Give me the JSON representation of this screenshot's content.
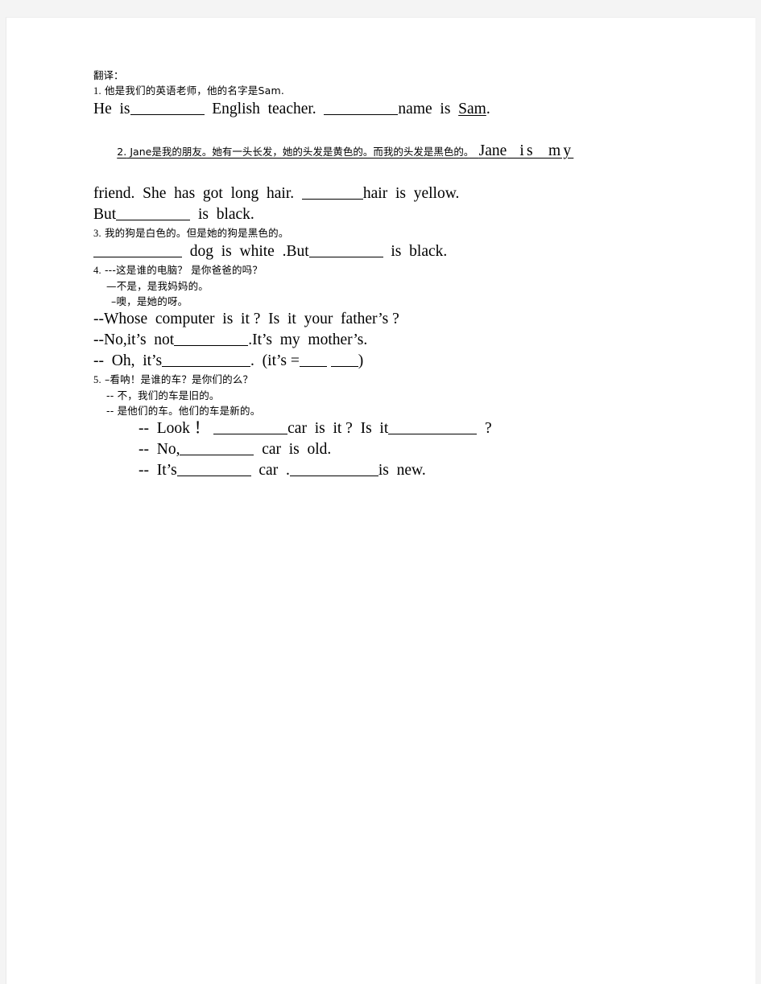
{
  "document": {
    "heading": "翻译：",
    "items": [
      {
        "id": "item-1",
        "number": "1.",
        "chinese": "他是我们的英语老师，他的名字是Sam.",
        "english_lines": [
          {
            "id": "item-1-answer-line",
            "segments": [
              {
                "type": "text",
                "value": "He  is"
              },
              {
                "type": "blank",
                "size": "lg"
              },
              {
                "type": "text",
                "value": "  English  teacher.  "
              },
              {
                "type": "blank",
                "size": "lg"
              },
              {
                "type": "text",
                "value": "name  is  "
              },
              {
                "type": "underlined",
                "value": "Sam"
              },
              {
                "type": "text",
                "value": "."
              }
            ]
          }
        ]
      },
      {
        "id": "item-2",
        "number": "2.",
        "chinese": "Jane是我的朋友。她有一头长发，她的头发是黄色的。而我的头发是黑色的。",
        "trailing_english": "Jane  is  my",
        "trailing_english_underlined_word": "Jane",
        "english_lines": [
          {
            "id": "item-2-answer-line-1",
            "segments": [
              {
                "type": "text",
                "value": "friend.  She  has  got  long  hair.  "
              },
              {
                "type": "blank",
                "size": "md"
              },
              {
                "type": "text",
                "value": "hair  is  yellow."
              }
            ]
          },
          {
            "id": "item-2-answer-line-2",
            "segments": [
              {
                "type": "text",
                "value": "But"
              },
              {
                "type": "blank",
                "size": "lg"
              },
              {
                "type": "text",
                "value": "  is  black."
              }
            ]
          }
        ]
      },
      {
        "id": "item-3",
        "number": "3.",
        "chinese": "我的狗是白色的。但是她的狗是黑色的。",
        "english_lines": [
          {
            "id": "item-3-answer-line",
            "segments": [
              {
                "type": "blank",
                "size": "xl"
              },
              {
                "type": "text",
                "value": "  dog  is  white  .But"
              },
              {
                "type": "blank",
                "size": "lg"
              },
              {
                "type": "text",
                "value": "  is  black."
              }
            ]
          }
        ]
      },
      {
        "id": "item-4",
        "number": "4.",
        "chinese_lines": [
          "---这是谁的电脑？ 是你爸爸的吗？",
          "—不是，是我妈妈的。",
          "–噢，是她的呀。"
        ],
        "english_lines": [
          {
            "id": "item-4-answer-line-1",
            "segments": [
              {
                "type": "text",
                "value": "--Whose  computer  is  it ?  Is  it  your  father’s ?"
              }
            ]
          },
          {
            "id": "item-4-answer-line-2",
            "segments": [
              {
                "type": "text",
                "value": "--No,it’s  not"
              },
              {
                "type": "blank",
                "size": "lg"
              },
              {
                "type": "text",
                "value": ".It’s  my  mother’s."
              }
            ]
          },
          {
            "id": "item-4-answer-line-3",
            "segments": [
              {
                "type": "text",
                "value": "--  Oh,  it’s"
              },
              {
                "type": "blank",
                "size": "xl"
              },
              {
                "type": "text",
                "value": ".  (it’s ="
              },
              {
                "type": "blank",
                "size": "xs"
              },
              {
                "type": "text",
                "value": " "
              },
              {
                "type": "blank",
                "size": "xs"
              },
              {
                "type": "text",
                "value": ")"
              }
            ]
          }
        ]
      },
      {
        "id": "item-5",
        "number": "5.",
        "chinese_lines": [
          "–看呐！是谁的车？是你们的么？",
          "-- 不，我们的车是旧的。",
          "-- 是他们的车。他们的车是新的。"
        ],
        "english_lines": [
          {
            "id": "item-5-answer-line-1",
            "segments": [
              {
                "type": "text",
                "value": "--  Look ！ "
              },
              {
                "type": "blank",
                "size": "lg"
              },
              {
                "type": "text",
                "value": "car  is  it ?  Is  it"
              },
              {
                "type": "blank",
                "size": "xl"
              },
              {
                "type": "text",
                "value": "  ?"
              }
            ]
          },
          {
            "id": "item-5-answer-line-2",
            "segments": [
              {
                "type": "text",
                "value": "--  No,"
              },
              {
                "type": "blank",
                "size": "lg"
              },
              {
                "type": "text",
                "value": "  car  is  old."
              }
            ]
          },
          {
            "id": "item-5-answer-line-3",
            "segments": [
              {
                "type": "text",
                "value": "--  It’s"
              },
              {
                "type": "blank",
                "size": "lg"
              },
              {
                "type": "text",
                "value": "  car  ."
              },
              {
                "type": "blank",
                "size": "xl"
              },
              {
                "type": "text",
                "value": "is  new."
              }
            ]
          }
        ]
      }
    ]
  },
  "colors": {
    "page_background": "#ffffff",
    "canvas_background": "#f4f4f4",
    "text": "#000000"
  }
}
